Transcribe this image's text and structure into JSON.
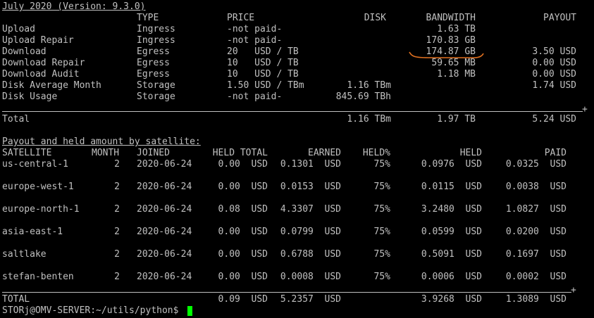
{
  "header_title": "July 2020 (Version: 9.3.0)",
  "columns": {
    "type": "TYPE",
    "price": "PRICE",
    "disk": "DISK",
    "bandwidth": "BANDWIDTH",
    "payout": "PAYOUT"
  },
  "rows": [
    {
      "name": "Upload",
      "type": "Ingress",
      "price": "-not paid-",
      "disk": "",
      "bandwidth": "1.63 TB",
      "payout": ""
    },
    {
      "name": "Upload Repair",
      "type": "Ingress",
      "price": "-not paid-",
      "disk": "",
      "bandwidth": "170.83 GB",
      "payout": ""
    },
    {
      "name": "Download",
      "type": "Egress",
      "price": "20   USD / TB",
      "disk": "",
      "bandwidth": "174.87 GB",
      "payout": "3.50 USD"
    },
    {
      "name": "Download Repair",
      "type": "Egress",
      "price": "10   USD / TB",
      "disk": "",
      "bandwidth": "59.65 MB",
      "payout": "0.00 USD"
    },
    {
      "name": "Download Audit",
      "type": "Egress",
      "price": "10   USD / TB",
      "disk": "",
      "bandwidth": "1.18 MB",
      "payout": "0.00 USD"
    },
    {
      "name": "Disk Average Month",
      "type": "Storage",
      "price": "1.50 USD / TBm",
      "disk": "1.16 TBm",
      "bandwidth": "",
      "payout": "1.74 USD"
    },
    {
      "name": "Disk Usage",
      "type": "Storage",
      "price": "-not paid-",
      "disk": "845.69 TBh",
      "bandwidth": "",
      "payout": ""
    }
  ],
  "total": {
    "label": "Total",
    "disk": "1.16 TBm",
    "bandwidth": "1.97 TB",
    "payout": "5.24 USD"
  },
  "satellite_section_title": "Payout and held amount by satellite:",
  "sat_columns": {
    "satellite": "SATELLITE",
    "month": "MONTH",
    "joined": "JOINED",
    "held_total": "HELD TOTAL",
    "earned": "EARNED",
    "held_pct": "HELD%",
    "held": "HELD",
    "paid": "PAID"
  },
  "satellites": [
    {
      "name": "us-central-1",
      "month": "2",
      "joined": "2020-06-24",
      "held_total": "0.00  USD",
      "earned": "0.1301  USD",
      "held_pct": "75%",
      "held": "0.0976  USD",
      "paid": "0.0325  USD"
    },
    {
      "name": "europe-west-1",
      "month": "2",
      "joined": "2020-06-24",
      "held_total": "0.00  USD",
      "earned": "0.0153  USD",
      "held_pct": "75%",
      "held": "0.0115  USD",
      "paid": "0.0038  USD"
    },
    {
      "name": "europe-north-1",
      "month": "2",
      "joined": "2020-06-24",
      "held_total": "0.08  USD",
      "earned": "4.3307  USD",
      "held_pct": "75%",
      "held": "3.2480  USD",
      "paid": "1.0827  USD"
    },
    {
      "name": "asia-east-1",
      "month": "2",
      "joined": "2020-06-24",
      "held_total": "0.00  USD",
      "earned": "0.0799  USD",
      "held_pct": "75%",
      "held": "0.0599  USD",
      "paid": "0.0200  USD"
    },
    {
      "name": "saltlake",
      "month": "2",
      "joined": "2020-06-24",
      "held_total": "0.00  USD",
      "earned": "0.6788  USD",
      "held_pct": "75%",
      "held": "0.5091  USD",
      "paid": "0.1697  USD"
    },
    {
      "name": "stefan-benten",
      "month": "2",
      "joined": "2020-06-24",
      "held_total": "0.00  USD",
      "earned": "0.0008  USD",
      "held_pct": "75%",
      "held": "0.0006  USD",
      "paid": "0.0002  USD"
    }
  ],
  "sat_total": {
    "label": "TOTAL",
    "held_total": "0.09  USD",
    "earned": "5.2357  USD",
    "held": "3.9268  USD",
    "paid": "1.3089  USD"
  },
  "prompt": "STORj@OMV-SERVER:~/utils/python$ ",
  "corner_mark": "+",
  "colors": {
    "background": "#000000",
    "text": "#c0c0c0",
    "cursor": "#00ff00",
    "annotation": "#e07020"
  }
}
